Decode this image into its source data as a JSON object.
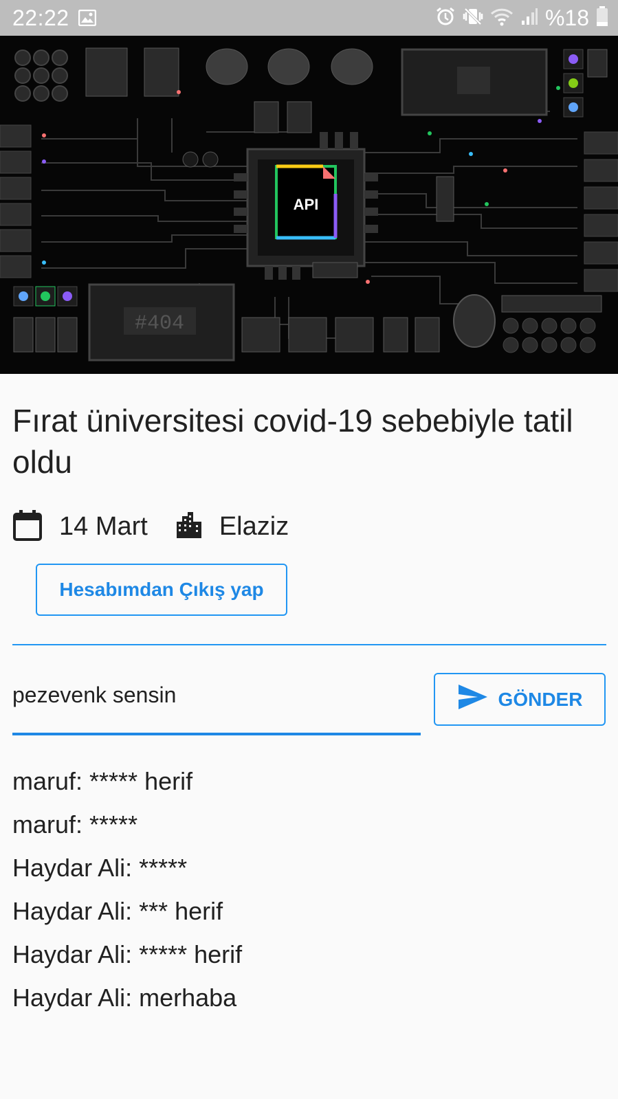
{
  "status_bar": {
    "time": "22:22",
    "battery": "%18",
    "icons": [
      "image-icon",
      "alarm-icon",
      "vibrate-icon",
      "wifi-icon",
      "signal-icon",
      "battery-icon"
    ]
  },
  "hero": {
    "chip_label": "API",
    "error_label": "#404"
  },
  "article": {
    "title": "Fırat üniversitesi covid-19 sebebiyle tatil oldu",
    "date": "14 Mart",
    "location": "Elaziz"
  },
  "actions": {
    "logout_label": "Hesabımdan Çıkış yap"
  },
  "comment_form": {
    "input_value": "pezevenk sensin",
    "send_label": "GÖNDER"
  },
  "messages": [
    "maruf: ***** herif",
    "maruf: *****",
    "Haydar Ali: *****",
    "Haydar Ali: *** herif",
    "Haydar Ali: ***** herif",
    "Haydar Ali: merhaba"
  ],
  "colors": {
    "accent": "#2196f3",
    "status_bar": "#bdbdbd",
    "background": "#fafafa",
    "text": "#212121"
  }
}
